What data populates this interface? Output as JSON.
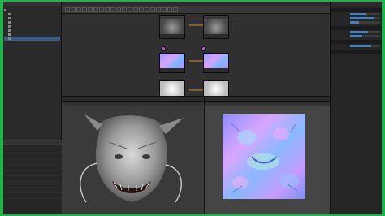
{
  "graph": {
    "title": "",
    "nodes": [
      {
        "id": "n1",
        "label": "",
        "thumb": "gray"
      },
      {
        "id": "n2",
        "label": "",
        "thumb": "gray"
      },
      {
        "id": "n3",
        "label": "",
        "thumb": "normal"
      },
      {
        "id": "n4",
        "label": "",
        "thumb": "normal"
      },
      {
        "id": "n5",
        "label": "",
        "thumb": "white"
      },
      {
        "id": "n6",
        "label": "",
        "thumb": "white"
      }
    ]
  },
  "explorer": {
    "items": [
      {
        "label": ""
      },
      {
        "label": ""
      },
      {
        "label": ""
      },
      {
        "label": ""
      },
      {
        "label": ""
      },
      {
        "label": ""
      },
      {
        "label": ""
      },
      {
        "label": ""
      }
    ]
  },
  "library": {
    "rows": [
      "",
      "",
      "",
      "",
      "",
      "",
      "",
      "",
      ""
    ]
  },
  "viewport3d": {
    "title": "",
    "menu": [
      "",
      "",
      "",
      "",
      ""
    ]
  },
  "viewport2d": {
    "title": ""
  },
  "properties": {
    "title": "",
    "sections": [
      "",
      "",
      "",
      ""
    ],
    "fields": [
      {
        "label": "",
        "level": 0.5
      },
      {
        "label": "",
        "level": 0.8
      },
      {
        "label": "",
        "level": 0.3
      },
      {
        "label": "",
        "level": 0.6
      },
      {
        "label": "",
        "level": 0.4
      },
      {
        "label": "",
        "level": 0.7
      }
    ]
  },
  "colors": {
    "accent": "#4a7fb5",
    "wire": "#e08a2c",
    "port": "#c060c0",
    "frame": "#22b14c"
  }
}
